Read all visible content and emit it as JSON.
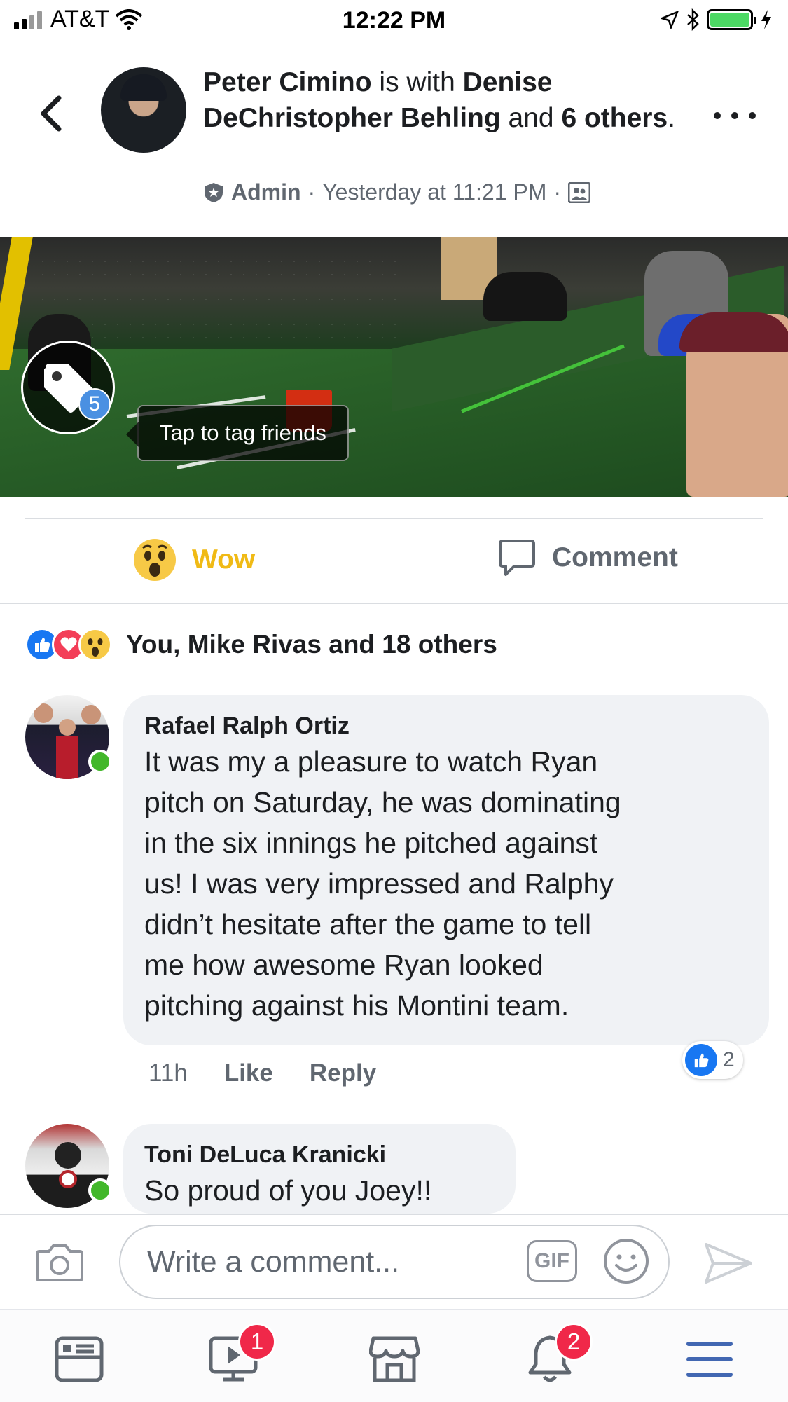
{
  "status_bar": {
    "carrier": "AT&T",
    "time": "12:22 PM",
    "battery_color": "#4cd964"
  },
  "header": {
    "author": "Peter Cimino",
    "with_text": " is with ",
    "tagged_person": "Denise DeChristopher Behling",
    "and_text": " and ",
    "others_link": "6 others",
    "period": ".",
    "role": "Admin",
    "timestamp": "Yesterday at 11:21 PM",
    "dot": "·",
    "icons": {
      "back": "chevron-left-icon",
      "more": "more-dots-icon",
      "role": "admin-shield-icon",
      "audience": "group-audience-icon"
    }
  },
  "photo": {
    "tag_count": "5",
    "tag_tip": "Tap to tag friends"
  },
  "actions": {
    "wow_label": "Wow",
    "comment_label": "Comment",
    "wow_color": "#f0ba15"
  },
  "reactions": {
    "summary": "You, Mike Rivas and 18 others",
    "types": [
      "like-reaction-icon",
      "love-reaction-icon",
      "wow-reaction-icon"
    ]
  },
  "comments": [
    {
      "name": "Rafael Ralph Ortiz",
      "lines": [
        "It was my a pleasure to watch Ryan",
        "pitch on Saturday, he was dominating",
        "in the six innings he pitched against",
        "us! I was very impressed and Ralphy",
        "didn’t hesitate after the game to tell",
        "me how awesome Ryan looked",
        "pitching against his Montini team."
      ],
      "time": "11h",
      "like_label": "Like",
      "reply_label": "Reply",
      "like_count": "2"
    },
    {
      "name": "Toni DeLuca Kranicki",
      "lines": [
        "So proud of you Joey!!"
      ]
    }
  ],
  "composer": {
    "placeholder": "Write a comment...",
    "gif_label": "GIF"
  },
  "tabbar": {
    "watch_badge": "1",
    "notifications_badge": "2",
    "active_color": "#4267b2"
  }
}
